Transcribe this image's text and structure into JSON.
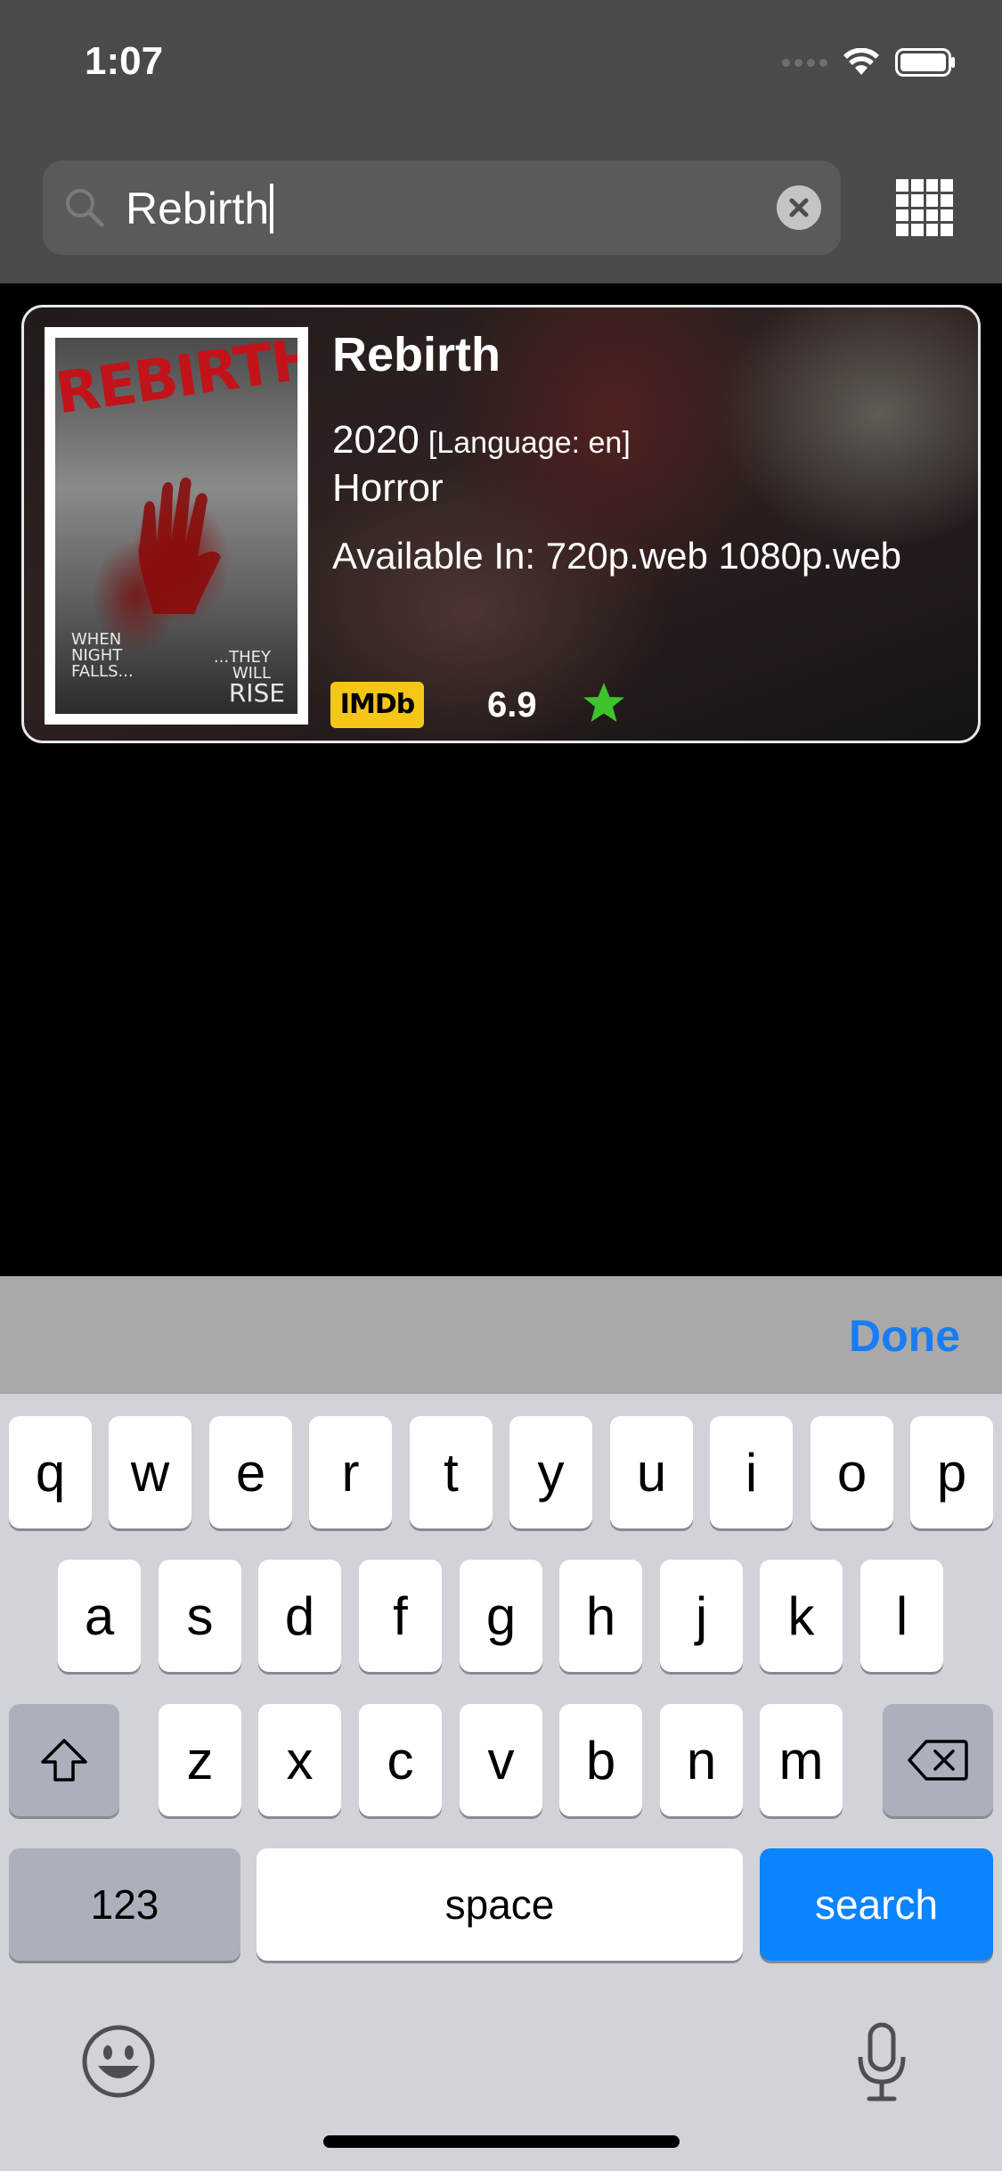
{
  "status_bar": {
    "time": "1:07"
  },
  "search": {
    "value": "Rebirth"
  },
  "result": {
    "title": "Rebirth",
    "year": "2020",
    "language": "[Language: en]",
    "genre": "Horror",
    "available": "Available In: 720p.web 1080p.web",
    "imdb_label": "IMDb",
    "rating": "6.9",
    "poster": {
      "title": "REBIRTH",
      "tagline_1": "WHEN NIGHT FALLS...",
      "tagline_2": "...THEY WILL",
      "tagline_3": "RISE"
    }
  },
  "toolbar": {
    "done_label": "Done"
  },
  "keyboard": {
    "row1": [
      "q",
      "w",
      "e",
      "r",
      "t",
      "y",
      "u",
      "i",
      "o",
      "p"
    ],
    "row2": [
      "a",
      "s",
      "d",
      "f",
      "g",
      "h",
      "j",
      "k",
      "l"
    ],
    "row3": [
      "z",
      "x",
      "c",
      "v",
      "b",
      "n",
      "m"
    ],
    "numbers_label": "123",
    "space_label": "space",
    "search_label": "search"
  },
  "colors": {
    "accent": "#0a84ff",
    "imdb": "#f5c518",
    "star": "#3ec32c",
    "header": "#4a4a4a"
  }
}
